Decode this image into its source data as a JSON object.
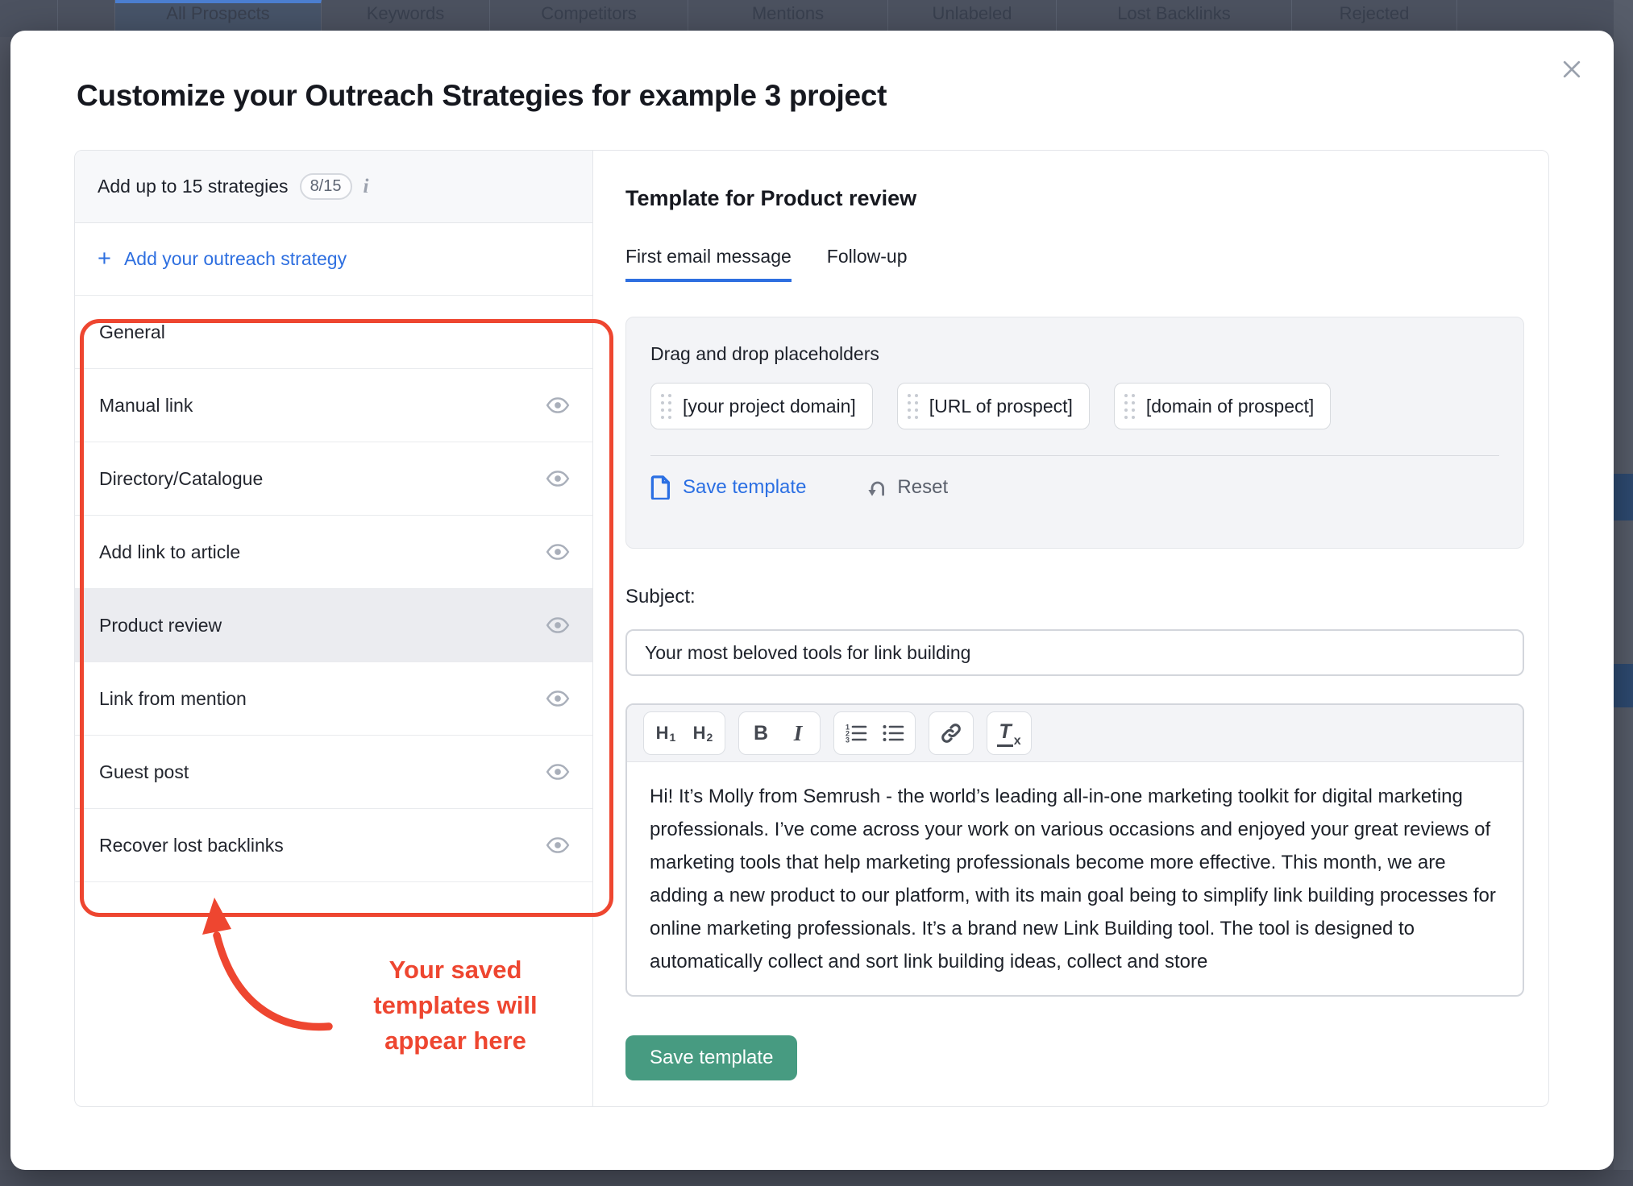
{
  "background_tabs": {
    "items": [
      {
        "label": "All Prospects",
        "active": true
      },
      {
        "label": "Keywords",
        "active": false
      },
      {
        "label": "Competitors",
        "active": false
      },
      {
        "label": "Mentions",
        "active": false
      },
      {
        "label": "Unlabeled",
        "active": false
      },
      {
        "label": "Lost Backlinks",
        "active": false
      },
      {
        "label": "Rejected",
        "active": false
      }
    ]
  },
  "modal": {
    "title": "Customize your Outreach Strategies for example 3 project",
    "close_icon": "x-icon"
  },
  "strategies": {
    "header_label": "Add up to 15 strategies",
    "count_badge": "8/15",
    "info_icon": "info-icon",
    "plus": "+",
    "add_label": "Add your outreach strategy",
    "items": [
      {
        "label": "General",
        "eye": false,
        "selected": false
      },
      {
        "label": "Manual link",
        "eye": true,
        "selected": false
      },
      {
        "label": "Directory/Catalogue",
        "eye": true,
        "selected": false
      },
      {
        "label": "Add link to article",
        "eye": true,
        "selected": false
      },
      {
        "label": "Product review",
        "eye": true,
        "selected": true
      },
      {
        "label": "Link from mention",
        "eye": true,
        "selected": false
      },
      {
        "label": "Guest post",
        "eye": true,
        "selected": false
      },
      {
        "label": "Recover lost backlinks",
        "eye": true,
        "selected": false
      }
    ]
  },
  "annotation": {
    "lines": [
      "Your saved",
      "templates will",
      "appear here"
    ],
    "color": "#ee4630"
  },
  "template_panel": {
    "heading": "Template for Product review",
    "tabs": [
      {
        "label": "First email message",
        "active": true
      },
      {
        "label": "Follow-up",
        "active": false
      }
    ],
    "placeholders": {
      "label": "Drag and drop placeholders",
      "chips": [
        "[your project domain]",
        "[URL of prospect]",
        "[domain of prospect]"
      ],
      "save_template_label": "Save template",
      "reset_label": "Reset"
    },
    "subject_label": "Subject:",
    "subject_value": "Your most beloved tools for link building",
    "toolbar": {
      "h1": "H",
      "h1_sub": "1",
      "h2": "H",
      "h2_sub": "2",
      "bold": "B",
      "italic": "I",
      "clear": "T",
      "clear_sub": "x"
    },
    "body_text": "Hi! It’s Molly from Semrush - the world’s leading all-in-one marketing toolkit for digital marketing professionals. I’ve come across your work on various occasions and enjoyed your great reviews of marketing tools that help marketing professionals become more effective. This month, we are adding a new product to our platform, with its main goal being to simplify link building processes for online marketing professionals. It’s a brand new Link Building tool. The tool is designed to automatically collect and sort link building ideas, collect and store",
    "save_button": "Save template"
  },
  "colors": {
    "accent_blue": "#2b6fe3",
    "annotation_red": "#ee4630",
    "save_green": "#479b81",
    "selected_row": "#ebecf0"
  }
}
